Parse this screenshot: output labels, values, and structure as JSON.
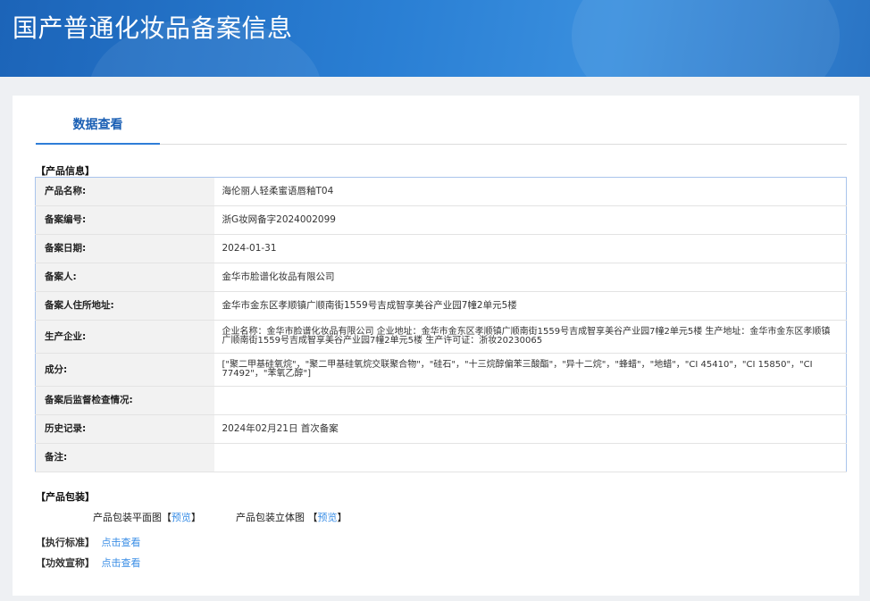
{
  "header": {
    "title": "国产普通化妆品备案信息"
  },
  "tabs": [
    {
      "label": "数据查看"
    }
  ],
  "product_info": {
    "section_label": "【产品信息】",
    "rows": [
      {
        "label": "产品名称:",
        "value": "海伦丽人轻柔蜜语唇釉T04"
      },
      {
        "label": "备案编号:",
        "value": "浙G妆网备字2024002099"
      },
      {
        "label": "备案日期:",
        "value": "2024-01-31"
      },
      {
        "label": "备案人:",
        "value": "金华市脸谱化妆品有限公司"
      },
      {
        "label": "备案人住所地址:",
        "value": "金华市金东区孝顺镇广顺南街1559号吉成智享美谷产业园7幢2单元5楼"
      },
      {
        "label": "生产企业:",
        "value": "企业名称：金华市脸谱化妆品有限公司 企业地址：金华市金东区孝顺镇广顺南街1559号吉成智享美谷产业园7幢2单元5楼 生产地址：金华市金东区孝顺镇广顺南街1559号吉成智享美谷产业园7幢2单元5楼 生产许可证：浙妆20230065"
      },
      {
        "label": "成分:",
        "value": "[\"聚二甲基硅氧烷\"，\"聚二甲基硅氧烷交联聚合物\"，\"硅石\"，\"十三烷醇偏苯三酸酯\"，\"异十二烷\"，\"蜂蜡\"，\"地蜡\"，\"CI 45410\"，\"CI 15850\"，\"CI 77492\"，\"苯氧乙醇\"]"
      },
      {
        "label": "备案后监督检查情况:",
        "value": ""
      },
      {
        "label": "历史记录:",
        "value": "2024年02月21日 首次备案"
      },
      {
        "label": "备注:",
        "value": ""
      }
    ]
  },
  "packaging": {
    "section_label": "【产品包装】",
    "flat_label": "产品包装平面图",
    "flat_link": "预览",
    "solid_label": "产品包装立体图 ",
    "solid_link": "预览",
    "bracket_open": "【",
    "bracket_close": "】"
  },
  "standard": {
    "label": "【执行标准】",
    "link": "点击查看"
  },
  "efficacy": {
    "label": "【功效宣称】",
    "link": "点击查看"
  }
}
